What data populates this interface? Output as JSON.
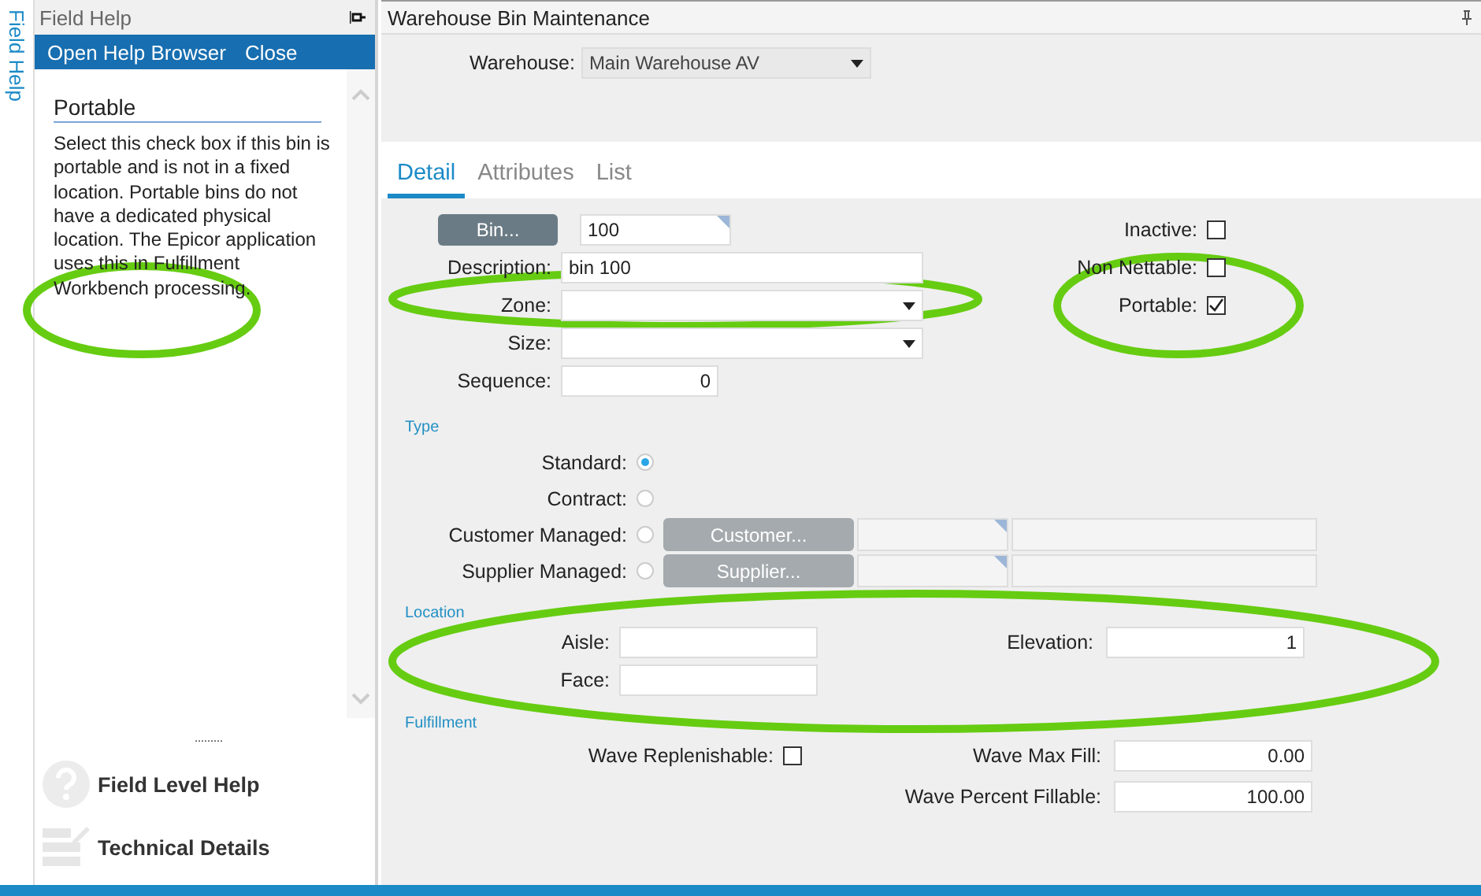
{
  "help_panel": {
    "side_tab": "Field Help",
    "title": "Field Help",
    "toolbar": [
      "Open Help Browser",
      "Close"
    ],
    "topic": "Portable",
    "text": "Select this check box if this bin is portable and is not in a fixed location. Portable bins do not have a dedicated physical location. The Epicor application uses this in Fulfillment Workbench processing.",
    "grip": "·········",
    "links": [
      {
        "kind": "help",
        "label": "Field Level Help"
      },
      {
        "kind": "details",
        "label": "Technical Details"
      }
    ]
  },
  "main": {
    "title": "Warehouse Bin Maintenance",
    "warehouse": {
      "label": "Warehouse:",
      "value": "Main Warehouse AV"
    },
    "tabs": [
      {
        "label": "Detail",
        "selected": true
      },
      {
        "label": "Attributes",
        "selected": false
      },
      {
        "label": "List",
        "selected": false
      }
    ],
    "bin": {
      "button": "Bin...",
      "value": "100"
    },
    "fields": [
      {
        "kind": "text",
        "label": "Description:",
        "value": "bin 100"
      },
      {
        "kind": "dropdown",
        "label": "Zone:"
      },
      {
        "kind": "dropdown",
        "label": "Size:"
      },
      {
        "kind": "number",
        "label": "Sequence:",
        "value": "0"
      }
    ],
    "flags": [
      {
        "label": "Inactive:",
        "checked": false
      },
      {
        "label": "Non Nettable:",
        "checked": false
      },
      {
        "label": "Portable:",
        "checked": true
      }
    ],
    "type_section": {
      "title": "Type",
      "options": [
        {
          "label": "Standard:",
          "selected": true
        },
        {
          "label": "Contract:",
          "selected": false
        },
        {
          "label": "Customer Managed:",
          "selected": false,
          "button": "Customer...",
          "disabled": true
        },
        {
          "label": "Supplier Managed:",
          "selected": false,
          "button": "Supplier...",
          "disabled": true
        }
      ]
    },
    "location": {
      "title": "Location",
      "left": [
        {
          "label": "Aisle:"
        },
        {
          "label": "Face:"
        }
      ],
      "right": [
        {
          "label": "Elevation:",
          "value": "1"
        }
      ]
    },
    "fulfillment": {
      "title": "Fulfillment",
      "wave_replenishable": {
        "label": "Wave Replenishable:",
        "checked": false
      },
      "fields": [
        {
          "label": "Wave Max Fill:",
          "value": "0.00"
        },
        {
          "label": "Wave Percent Fillable:",
          "value": "100.00"
        }
      ]
    }
  }
}
